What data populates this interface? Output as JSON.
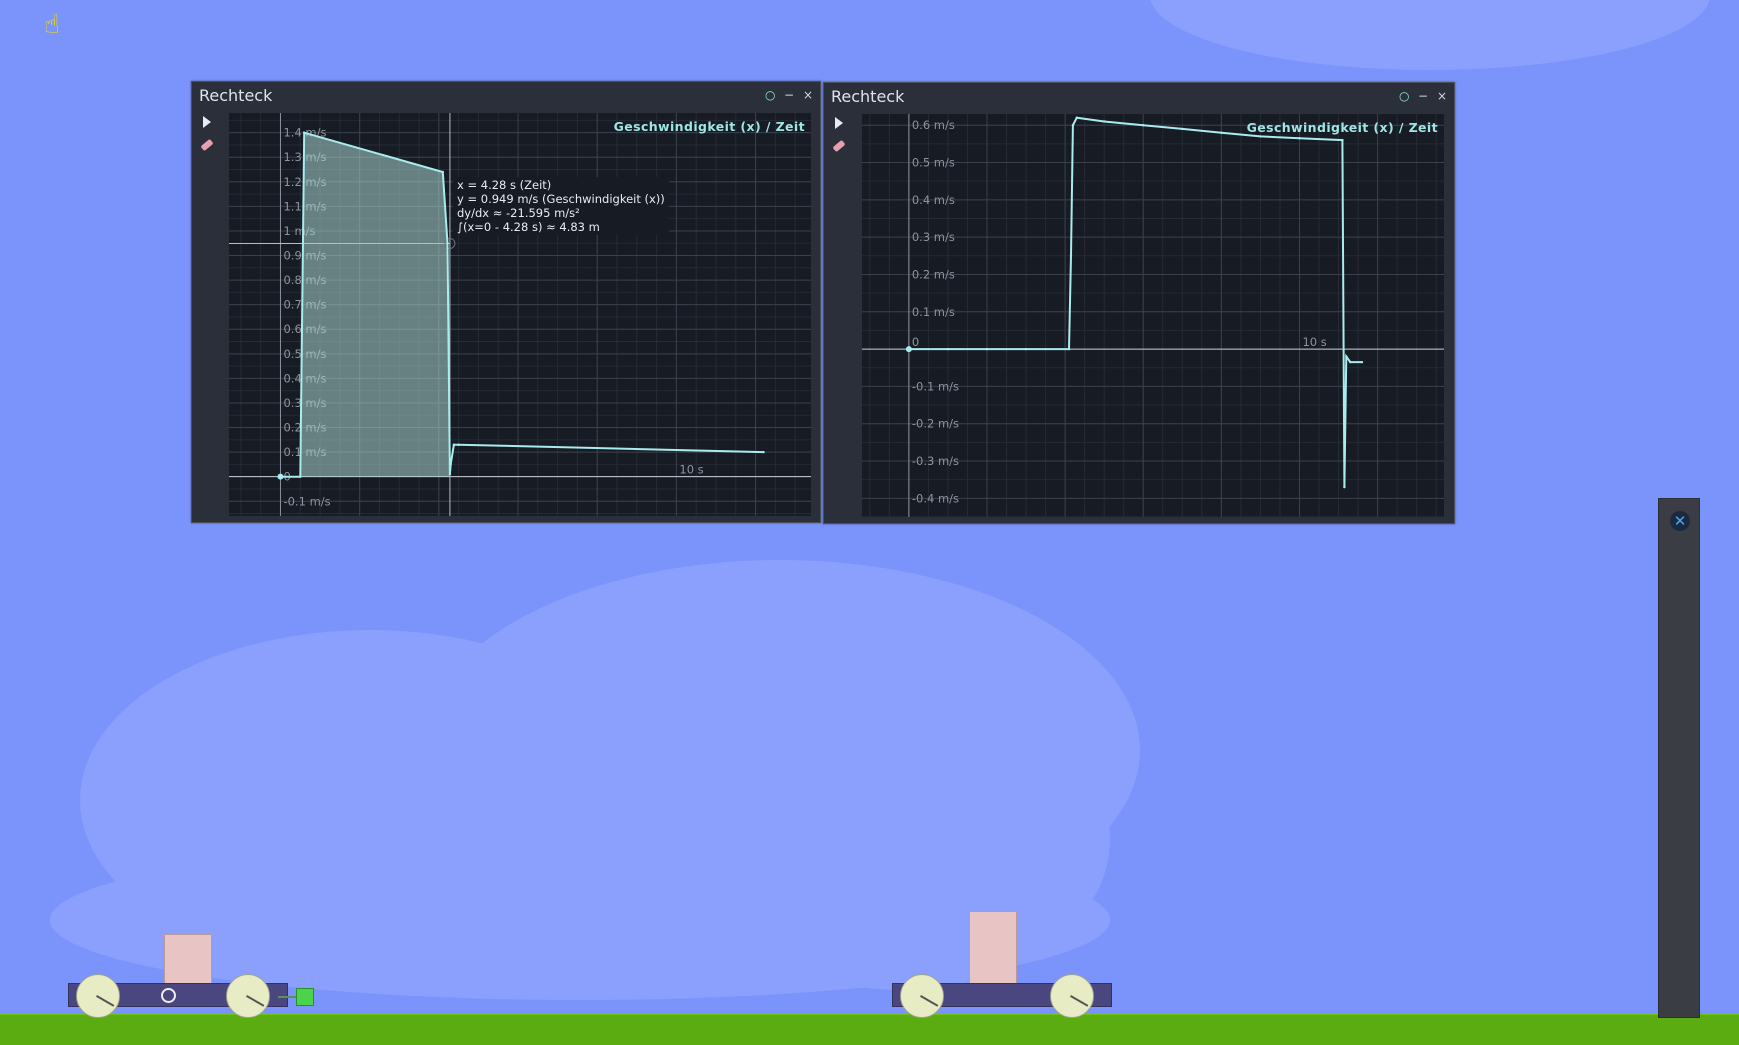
{
  "windows": [
    {
      "title": "Rechteck",
      "caption": "Geschwindigkeit (x) / Zeit",
      "tooltip": [
        "x = 4.28 s (Zeit)",
        "y = 0.949 m/s (Geschwindigkeit (x))",
        "dy/dx ≈ -21.595 m/s²",
        "∫(x=0 - 4.28 s) ≈ 4.83 m"
      ],
      "x_tick_labels": [
        "10 s"
      ],
      "y_tick_labels": [
        "1.4 m/s",
        "1.3 m/s",
        "1.2 m/s",
        "1.1 m/s",
        "1 m/s",
        "0.9 m/s",
        "0.8 m/s",
        "0.7 m/s",
        "0.6 m/s",
        "0.5 m/s",
        "0.4 m/s",
        "0.3 m/s",
        "0.2 m/s",
        "0.1 m/s",
        "0",
        "-0.1 m/s"
      ]
    },
    {
      "title": "Rechteck",
      "caption": "Geschwindigkeit (x) / Zeit",
      "x_tick_labels": [
        "0",
        "10 s"
      ],
      "y_tick_labels": [
        "0.6 m/s",
        "0.5 m/s",
        "0.4 m/s",
        "0.3 m/s",
        "0.2 m/s",
        "0.1 m/s",
        "-0.1 m/s",
        "-0.2 m/s",
        "-0.3 m/s",
        "-0.4 m/s"
      ]
    }
  ],
  "window_buttons": {
    "pin": "○",
    "minimize": "−",
    "close": "×"
  },
  "dock": {
    "close_label": "✕"
  },
  "cursor_icon": "☝",
  "chart_data": [
    {
      "type": "line",
      "title": "Geschwindigkeit (x) / Zeit",
      "x_unit": "s",
      "y_unit": "m/s",
      "xlim": [
        -1.3,
        13.4
      ],
      "ylim": [
        -0.16,
        1.48
      ],
      "series": [
        {
          "x": [
            0,
            0.5,
            0.6,
            4.1,
            4.22,
            4.28,
            4.3,
            4.38,
            4.5,
            12.2
          ],
          "y": [
            0,
            0,
            1.4,
            1.24,
            0.95,
            0.01,
            0.05,
            0.13,
            0.13,
            0.1
          ]
        }
      ],
      "shaded_integral": {
        "from": 0,
        "to": 4.28,
        "value": "4.83 m"
      },
      "cursor": {
        "x": 4.28,
        "y": 0.949
      }
    },
    {
      "type": "line",
      "title": "Geschwindigkeit (x) / Zeit",
      "x_unit": "s",
      "y_unit": "m/s",
      "xlim": [
        -1.2,
        13.7
      ],
      "ylim": [
        -0.45,
        0.63
      ],
      "series": [
        {
          "x": [
            0,
            1,
            2,
            3,
            4.1,
            4.15,
            4.2,
            4.3,
            5,
            6,
            7,
            8,
            9,
            10,
            11.1,
            11.15,
            11.2,
            11.3,
            11.6
          ],
          "y": [
            0,
            0,
            0,
            0,
            0,
            0.25,
            0.6,
            0.62,
            0.61,
            0.6,
            0.59,
            0.58,
            0.57,
            0.565,
            0.56,
            -0.37,
            -0.02,
            -0.035,
            -0.035
          ]
        }
      ]
    }
  ]
}
